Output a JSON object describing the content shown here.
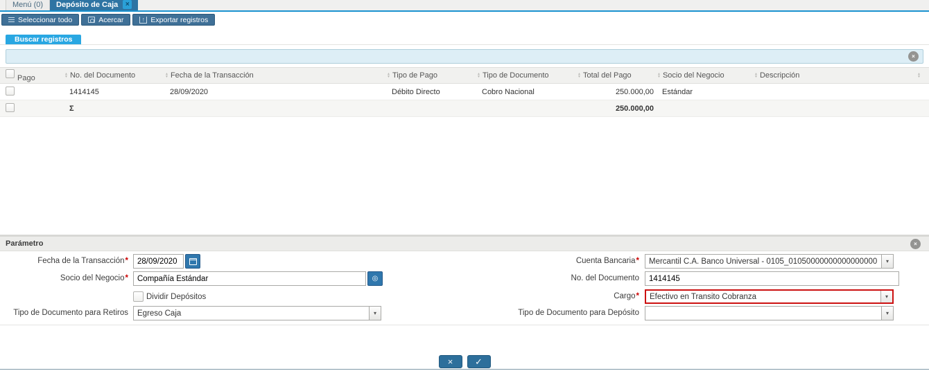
{
  "tabs": {
    "menu_label": "Menú (0)",
    "active_label": "Depósito de Caja"
  },
  "toolbar": {
    "select_all_label": "Seleccionar todo",
    "zoom_label": "Acercar",
    "export_label": "Exportar registros"
  },
  "search": {
    "tab_label": "Buscar registros",
    "value": "",
    "placeholder": ""
  },
  "table": {
    "columns": {
      "pago": "Pago",
      "doc_no": "No. del Documento",
      "trx_date": "Fecha de la Transacción",
      "payment_type": "Tipo de Pago",
      "doc_type": "Tipo de Documento",
      "total": "Total del Pago",
      "partner": "Socio del Negocio",
      "description": "Descripción"
    },
    "rows": [
      {
        "doc_no": "1414145",
        "trx_date": "28/09/2020",
        "payment_type": "Débito Directo",
        "doc_type": "Cobro Nacional",
        "total": "250.000,00",
        "partner": "Estándar",
        "description": ""
      },
      {
        "doc_no": "Σ",
        "trx_date": "",
        "payment_type": "",
        "doc_type": "",
        "total": "250.000,00",
        "partner": "",
        "description": ""
      }
    ]
  },
  "params": {
    "title": "Parámetro",
    "required_marker": "*",
    "fields": {
      "trx_date": {
        "label": "Fecha de la Transacción",
        "value": "28/09/2020"
      },
      "partner": {
        "label": "Socio del Negocio",
        "value": "Compañía Estándar"
      },
      "split_deposits": {
        "label": "Dividir Depósitos",
        "checked": false
      },
      "withdrawal_doc_type": {
        "label": "Tipo de Documento para Retiros",
        "value": "Egreso Caja"
      },
      "bank_account": {
        "label": "Cuenta Bancaria",
        "value": "Mercantil C.A. Banco Universal - 0105_01050000000000000000"
      },
      "doc_no": {
        "label": "No. del Documento",
        "value": "1414145"
      },
      "charge": {
        "label": "Cargo",
        "value": "Efectivo en Transito Cobranza",
        "highlighted": true
      },
      "deposit_doc_type": {
        "label": "Tipo de Documento para Depósito",
        "value": ""
      }
    }
  },
  "confirm": {
    "cancel_glyph": "×",
    "ok_glyph": "✓"
  },
  "icons": {
    "close": "×",
    "sort_up": "▲",
    "sort_down": "▼",
    "dropdown": "▾",
    "record": "◎",
    "up_arrow": "↑"
  },
  "colors": {
    "active_tab": "#2e74a3",
    "tab_underline": "#1a92d0",
    "toolbar_button": "#3f7097",
    "search_tab": "#29a7e2",
    "search_box_bg": "#ddeef6",
    "field_button": "#2f77ad",
    "confirm_button": "#2d6f9b",
    "required": "#cc0000",
    "highlight_border": "#cc1111"
  }
}
